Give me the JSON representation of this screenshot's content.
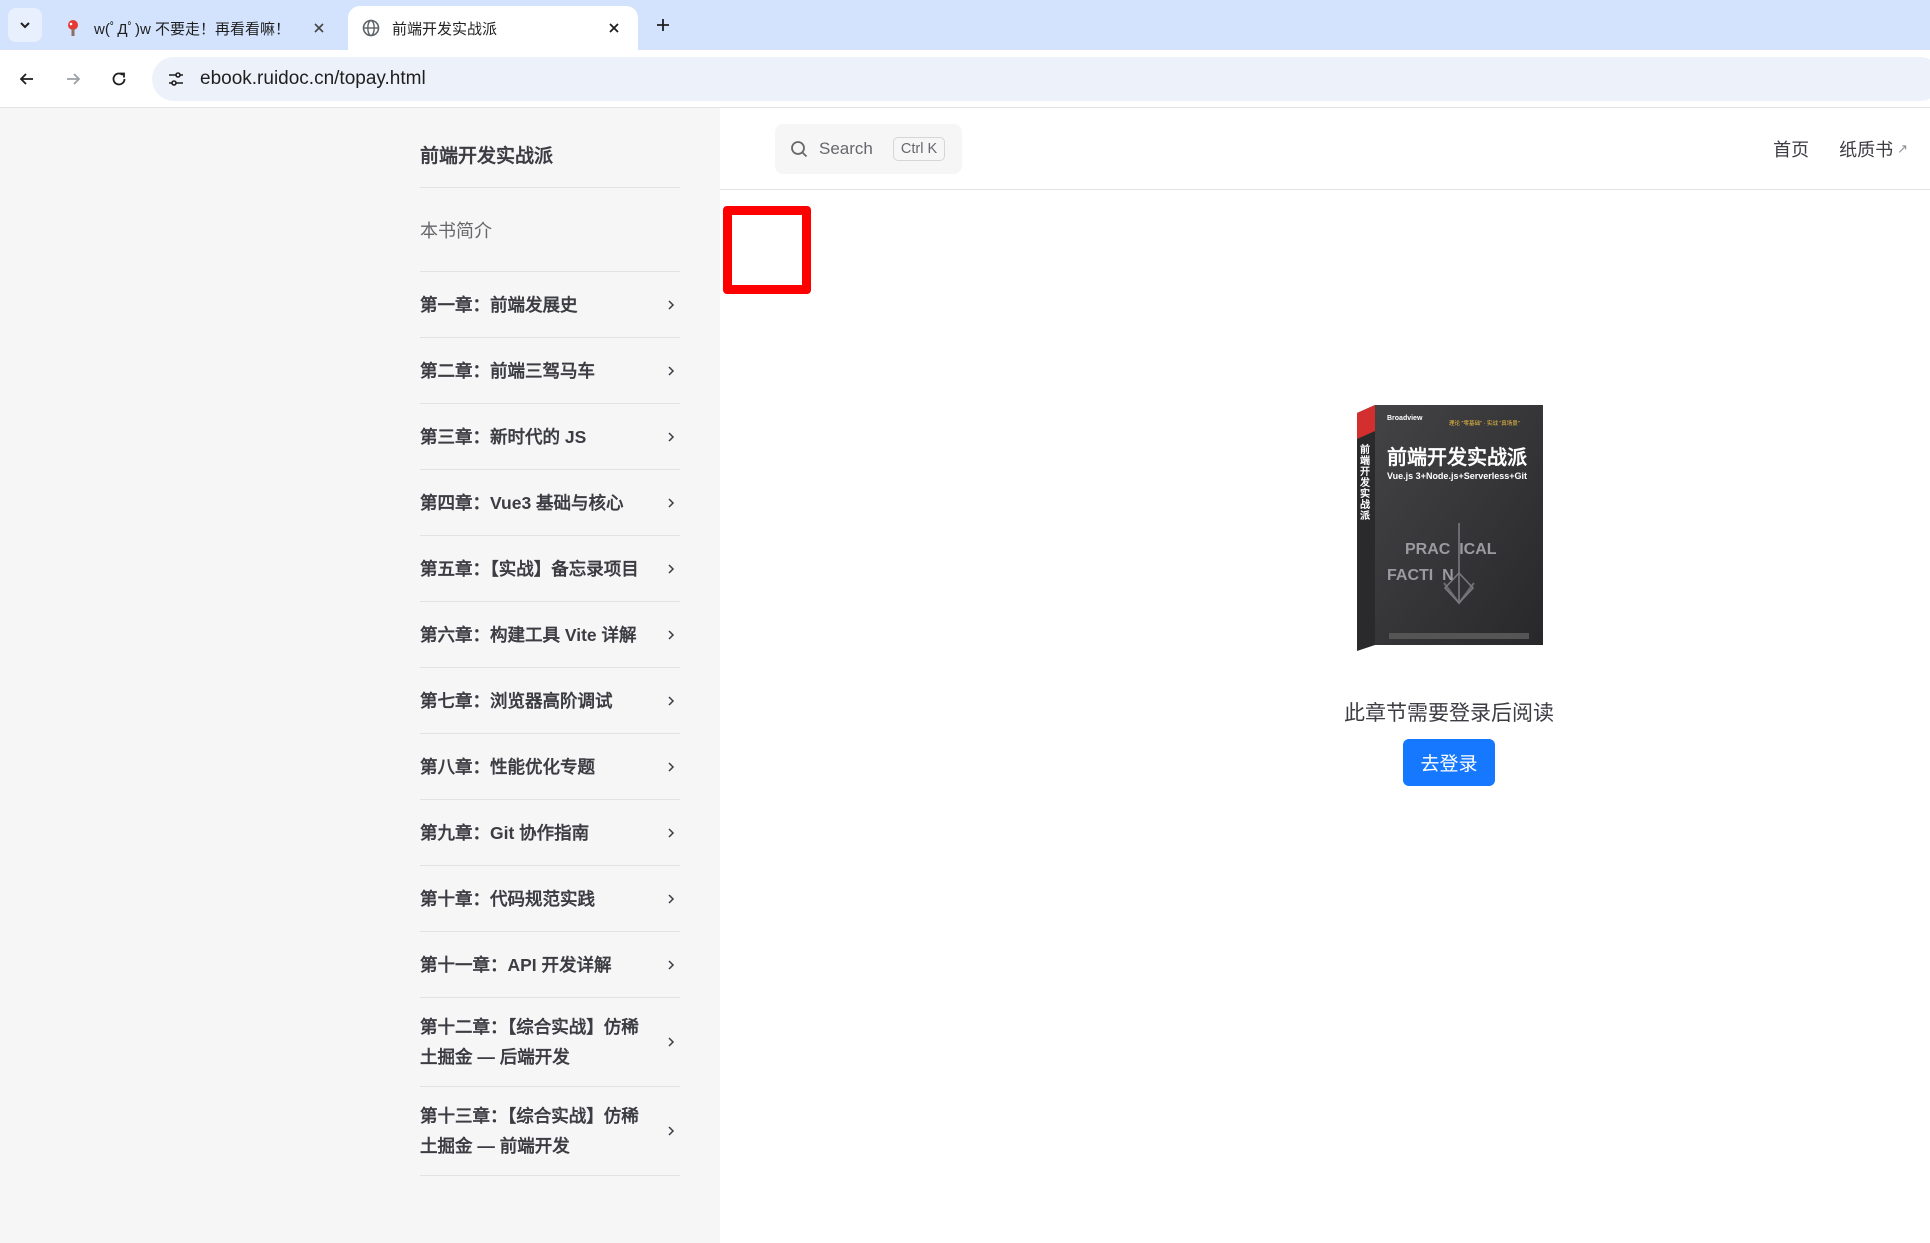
{
  "browser": {
    "tabs": [
      {
        "title": "w(ﾟДﾟ)w 不要走！再看看嘛！",
        "active": false
      },
      {
        "title": "前端开发实战派",
        "active": true
      }
    ],
    "url": "ebook.ruidoc.cn/topay.html",
    "icons": {
      "tab_search": "chevron-down-icon",
      "close": "close-icon",
      "new_tab": "plus-icon",
      "back": "arrow-left-icon",
      "forward": "arrow-right-icon",
      "reload": "reload-icon",
      "site_info": "tune-icon"
    }
  },
  "sidebar": {
    "title": "前端开发实战派",
    "intro": "本书简介",
    "chapters": [
      "第一章：前端发展史",
      "第二章：前端三驾马车",
      "第三章：新时代的 JS",
      "第四章：Vue3 基础与核心",
      "第五章：【实战】备忘录项目",
      "第六章：构建工具 Vite 详解",
      "第七章：浏览器高阶调试",
      "第八章：性能优化专题",
      "第九章：Git 协作指南",
      "第十章：代码规范实践",
      "第十一章：API 开发详解",
      "第十二章：【综合实战】仿稀土掘金 — 后端开发",
      "第十三章：【综合实战】仿稀土掘金 — 前端开发"
    ]
  },
  "topbar": {
    "search_label": "Search",
    "search_shortcut": "Ctrl K",
    "nav": [
      {
        "label": "首页"
      },
      {
        "label": "纸质书",
        "ext": "↗"
      }
    ]
  },
  "main": {
    "cover": {
      "title": "前端开发实战派",
      "subtitle": "Vue.js 3+Node.js+Serverless+Git",
      "publisher": "Broadview",
      "tagline": "理论 \"零基础\"  · 实战 \"真场景\"",
      "word1": "PRAC  ICAL",
      "word2": "FACTI  N",
      "spine": "前端开发实战派"
    },
    "notice": "此章节需要登录后阅读",
    "login_button": "去登录"
  },
  "colors": {
    "accent": "#1677ff",
    "highlight_box": "#ff0000",
    "sidebar_bg": "#f6f6f7"
  }
}
